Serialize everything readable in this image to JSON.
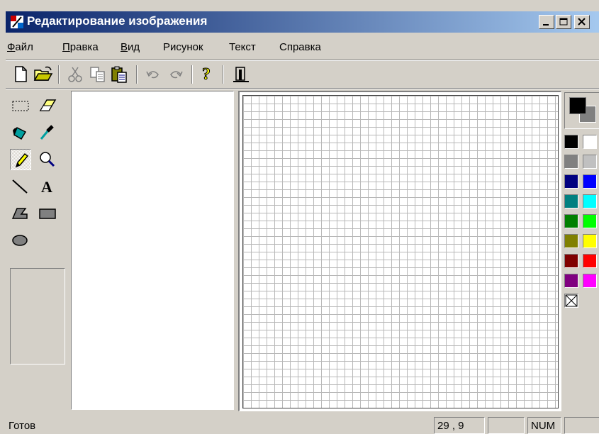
{
  "window": {
    "title": "Редактирование изображения",
    "buttons": [
      "minimize",
      "maximize",
      "close"
    ]
  },
  "menu": {
    "items": [
      {
        "accel": "Ф",
        "rest": "айл"
      },
      {
        "accel": "П",
        "rest": "равка"
      },
      {
        "accel": "В",
        "rest": "ид"
      },
      {
        "accel": "",
        "rest": "Рисунок"
      },
      {
        "accel": "",
        "rest": "Текст"
      },
      {
        "accel": "",
        "rest": "Справка"
      }
    ]
  },
  "toolbar": {
    "icons": [
      "new-icon",
      "open-icon",
      "cut-icon",
      "copy-icon",
      "paste-icon",
      "undo-icon",
      "redo-icon",
      "help-icon",
      "test-icon"
    ]
  },
  "tools": {
    "icons": [
      "free-select-icon",
      "eraser-icon",
      "fill-icon",
      "pick-color-icon",
      "pencil-icon",
      "magnifier-icon",
      "line-icon",
      "text-icon",
      "polygon-icon",
      "rectangle-icon",
      "ellipse-icon"
    ],
    "active": "pencil-icon"
  },
  "palette": {
    "foreground": "#000000",
    "background": "#808080",
    "colors": [
      "#000000",
      "#ffffff",
      "#808080",
      "#c0c0c0",
      "#000080",
      "#0000ff",
      "#008080",
      "#00ffff",
      "#008000",
      "#00ff00",
      "#808000",
      "#ffff00",
      "#800000",
      "#ff0000",
      "#800080",
      "#ff00ff"
    ]
  },
  "status": {
    "text": "Готов",
    "coords": "29 , 9",
    "size": "",
    "num": "NUM",
    "extra": ""
  }
}
